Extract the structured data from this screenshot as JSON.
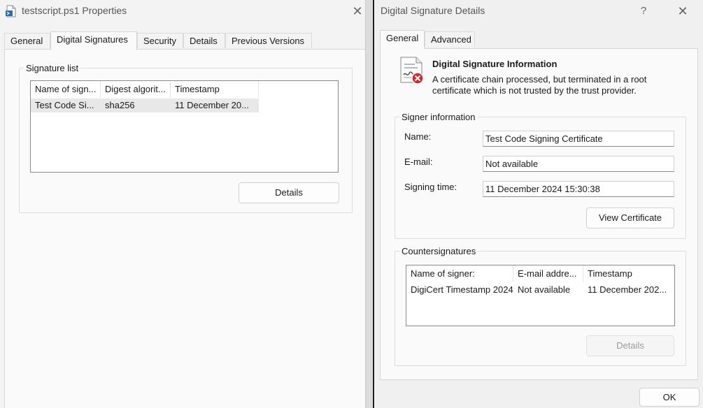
{
  "left_window": {
    "title": "testscript.ps1 Properties",
    "tabs": [
      "General",
      "Digital Signatures",
      "Security",
      "Details",
      "Previous Versions"
    ],
    "active_tab": "Digital Signatures",
    "signature_list": {
      "legend": "Signature list",
      "columns": [
        "Name of sign...",
        "Digest algorit...",
        "Timestamp"
      ],
      "rows": [
        [
          "Test Code Si...",
          "sha256",
          "11 December 20..."
        ]
      ]
    },
    "details_button": "Details"
  },
  "right_window": {
    "title": "Digital Signature Details",
    "help_glyph": "?",
    "tabs": [
      "General",
      "Advanced"
    ],
    "active_tab": "General",
    "info_heading": "Digital Signature Information",
    "info_text": "A certificate chain processed, but terminated in a root certificate which is not trusted by the trust provider.",
    "signer": {
      "legend": "Signer information",
      "name_label": "Name:",
      "name_value": "Test Code Signing Certificate",
      "email_label": "E-mail:",
      "email_value": "Not available",
      "time_label": "Signing time:",
      "time_value": "11 December 2024 15:30:38",
      "view_button": "View Certificate"
    },
    "countersignatures": {
      "legend": "Countersignatures",
      "columns": [
        "Name of signer:",
        "E-mail addre...",
        "Timestamp"
      ],
      "rows": [
        [
          "DigiCert Timestamp 2024",
          "Not available",
          "11 December 202..."
        ]
      ],
      "details_button": "Details"
    },
    "ok_button": "OK"
  },
  "colors": {
    "error_red": "#d9232e",
    "window_bg": "#f0f0f0"
  },
  "icons": {
    "file_icon": "powershell-file-icon",
    "signature_icon": "certificate-error-icon"
  }
}
